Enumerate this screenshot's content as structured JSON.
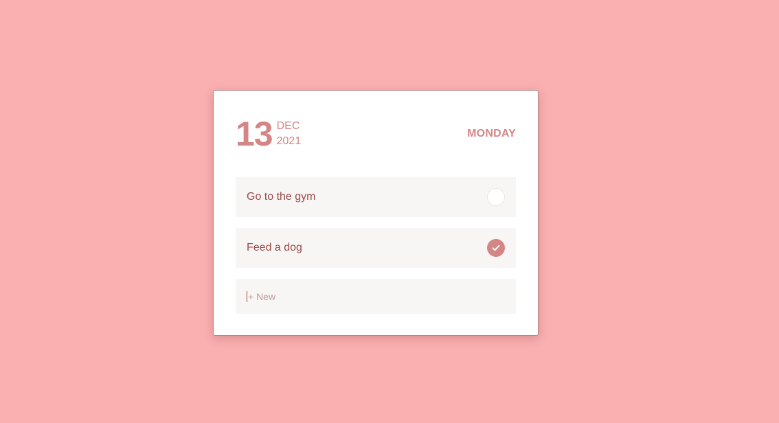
{
  "header": {
    "day": "13",
    "month": "DEC",
    "year": "2021",
    "weekday": "MONDAY"
  },
  "tasks": [
    {
      "label": "Go to the gym",
      "done": false
    },
    {
      "label": "Feed a dog",
      "done": true
    }
  ],
  "new_task": {
    "placeholder": "+ New",
    "value": ""
  },
  "colors": {
    "background": "#fab0b0",
    "accent": "#d48585",
    "task_text": "#9c4a4a",
    "task_bg": "#f8f6f4"
  }
}
